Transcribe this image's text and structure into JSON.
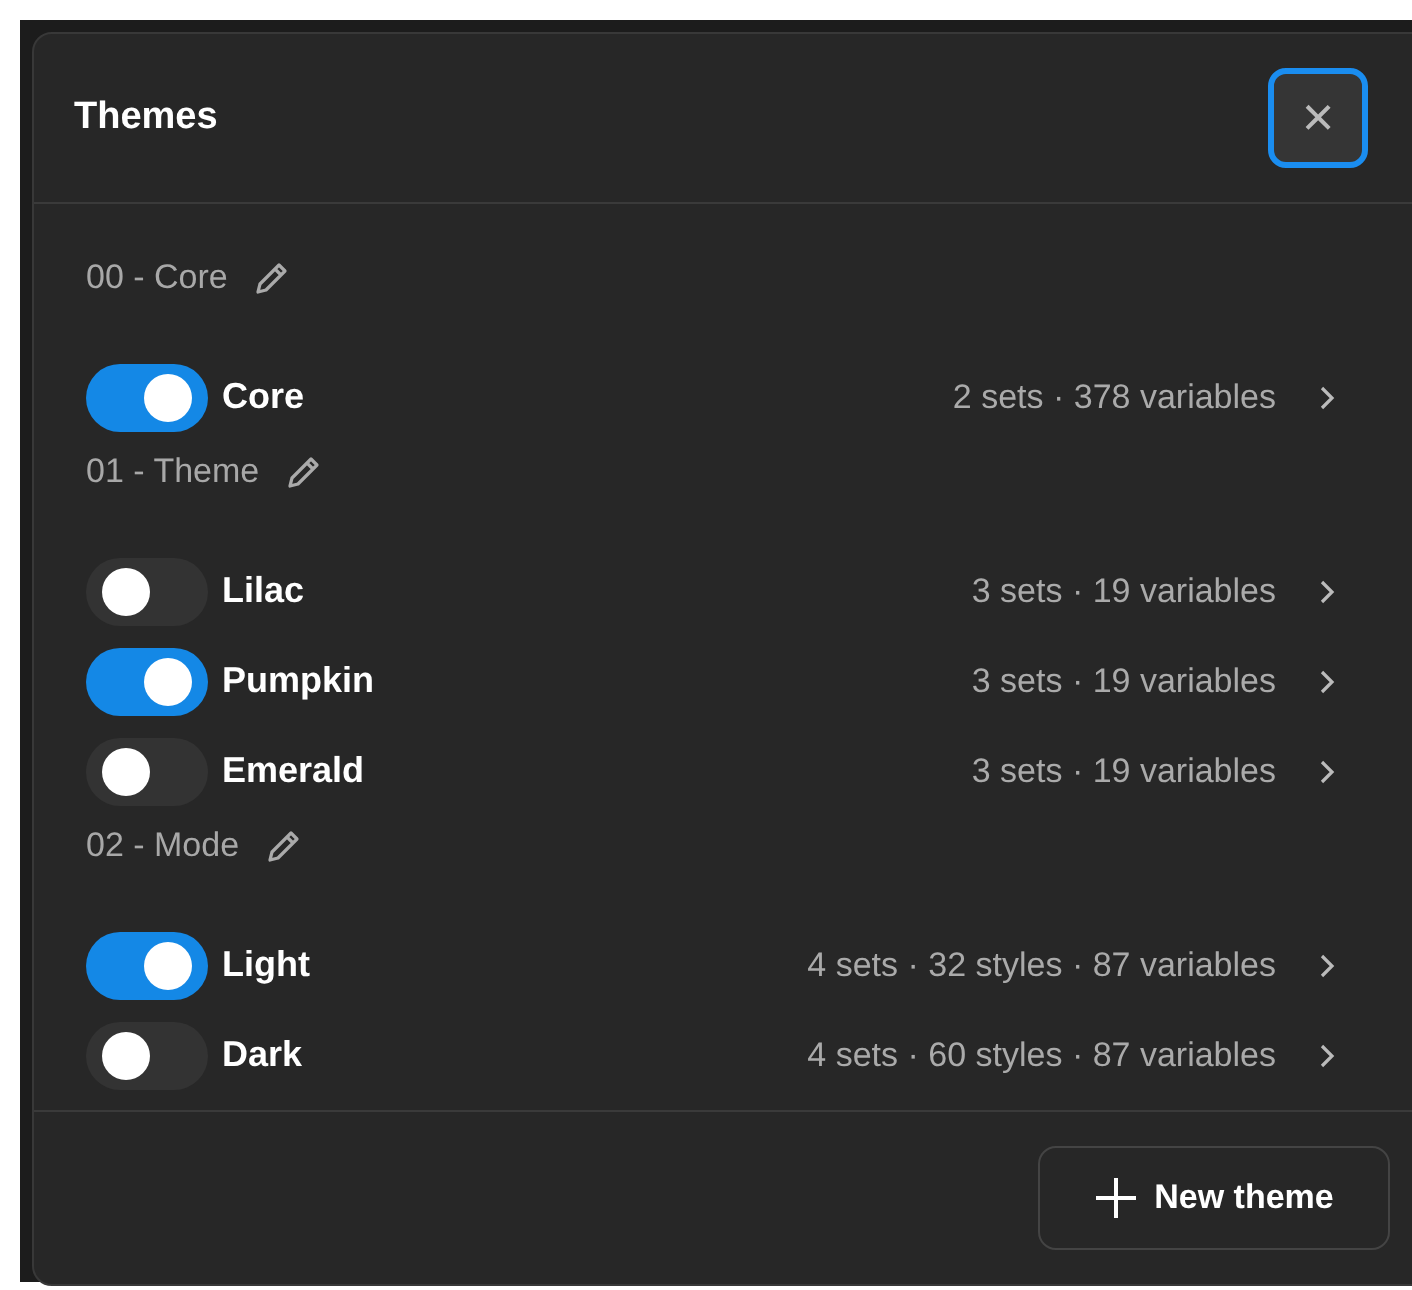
{
  "dialog": {
    "title": "Themes",
    "close_label": "×"
  },
  "groups": [
    {
      "name": "00 - Core",
      "themes": [
        {
          "name": "Core",
          "on": true,
          "summary": "2 sets · 378 variables"
        }
      ]
    },
    {
      "name": "01 - Theme",
      "themes": [
        {
          "name": "Lilac",
          "on": false,
          "summary": "3 sets · 19 variables"
        },
        {
          "name": "Pumpkin",
          "on": true,
          "summary": "3 sets · 19 variables"
        },
        {
          "name": "Emerald",
          "on": false,
          "summary": "3 sets · 19 variables"
        }
      ]
    },
    {
      "name": "02 - Mode",
      "themes": [
        {
          "name": "Light",
          "on": true,
          "summary": "4 sets · 32 styles · 87 variables"
        },
        {
          "name": "Dark",
          "on": false,
          "summary": "4 sets · 60 styles · 87 variables"
        }
      ]
    }
  ],
  "footer": {
    "button": "New theme"
  }
}
